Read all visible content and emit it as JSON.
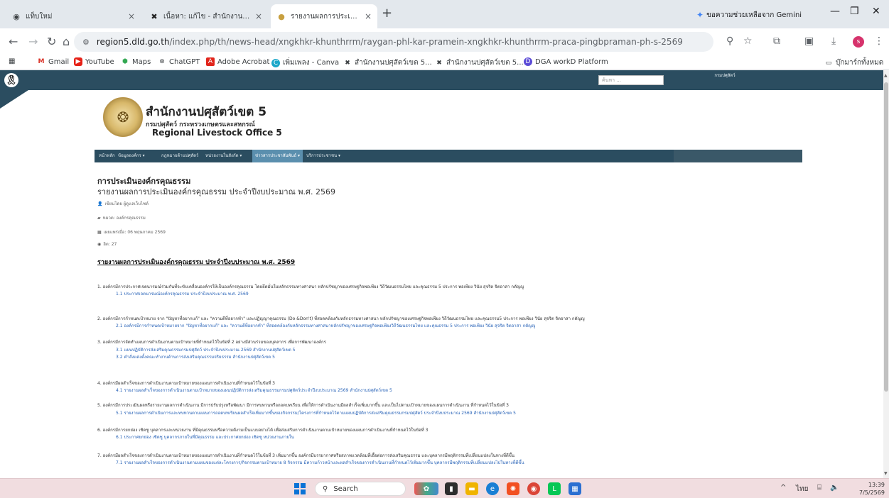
{
  "tabs": [
    {
      "title": "แท็บใหม่",
      "icon": "chrome-icon"
    },
    {
      "title": "เนื้อหา: แก้ไข - สำนักงานปศุสัตว์เขต",
      "icon": "dld-logo-icon"
    },
    {
      "title": "รายงานผลการประเมินองค์กรคุณธรรม",
      "icon": "site-favicon-icon"
    }
  ],
  "gemini_label": "ขอความช่วยเหลือจาก Gemini",
  "address": {
    "host": "region5.dld.go.th",
    "path": "/index.php/th/news-head/xngkhkr-khunthrrm/raygan-phl-kar-pramein-xngkhkr-khunthrrm-praca-pingbpraman-ph-s-2569"
  },
  "bookmarks": [
    {
      "label": "Gmail",
      "icon": "gmail-icon"
    },
    {
      "label": "YouTube",
      "icon": "youtube-icon"
    },
    {
      "label": "Maps",
      "icon": "maps-icon"
    },
    {
      "label": "ChatGPT",
      "icon": "chatgpt-icon"
    },
    {
      "label": "Adobe Acrobat",
      "icon": "acrobat-icon"
    },
    {
      "label": "เพิ่มเพลง - Canva",
      "icon": "canva-icon"
    },
    {
      "label": "สำนักงานปศุสัตว์เขต 5...",
      "icon": "dld-logo-icon"
    },
    {
      "label": "สำนักงานปศุสัตว์เขต 5...",
      "icon": "dld-logo-icon"
    },
    {
      "label": "DGA workD Platform",
      "icon": "dga-icon"
    }
  ],
  "all_bookmarks": "บุ๊กมาร์กทั้งหมด",
  "site": {
    "search_placeholder": "ค้นหา ...",
    "dept_link": "กรมปศุสัตว์",
    "title_th": "สำนักงานปศุสัตว์เขต 5",
    "subtitle_th": "กรมปศุสัตว์ กระทรวงเกษตรและสหกรณ์",
    "title_en": "Regional Livestock Office 5",
    "nav": [
      "หน้าหลัก",
      "ข้อมูลองค์กร ▾",
      "กฎหมายด้านปศุสัตว์",
      "หน่วยงานในสังกัด ▾",
      "ข่าวสารประชาสัมพันธ์ ▾",
      "บริการประชาชน ▾"
    ]
  },
  "article": {
    "heading": "การประเมินองค์กรคุณธรรม",
    "subheading": "รายงานผลการประเมินองค์กรคุณธรรม ประจำปีงบประมาณ พ.ศ. 2569",
    "meta": [
      "เขียนโดย ผู้ดูแลเว็บไซต์",
      "หมวด: องค์กรคุณธรรม",
      "เผยแพร่เมื่อ: 06 พฤษภาคม 2569",
      "ฮิต: 27"
    ],
    "section_title": "รายงานผลการประเมินองค์กรคุณธรรม ประจำปีงบประมาณ พ.ศ. 2569",
    "items": [
      {
        "text": "1. องค์กรมีการประกาศเจตนารมณ์ร่วมกันที่จะขับเคลื่อนองค์กรให้เป็นองค์กรคุณธรรม โดยยึดมั่นในหลักธรรมทางศาสนา หลักปรัชญาของเศรษฐกิจพอเพียง วิถีวัฒนธรรมไทย และคุณธรรม 5 ประการ พอเพียง วินัย สุจริต จิตอาสา กตัญญู",
        "subs": [
          "1.1 ประกาศเจตนารมณ์องค์กรคุณธรรม ประจำปีงบประมาณ พ.ศ. 2569"
        ]
      },
      {
        "text": "2. องค์กรมีการกำหนดเป้าหมาย จาก \"ปัญหาที่อยากแก้\" และ \"ความดีที่อยากทำ\" และปฏิญญาคุณธรรม (Do &Don't) ที่สอดคล้องกับหลักธรรมทางศาสนา หลักปรัชญาของเศรษฐกิจพอเพียง วิถีวัฒนธรรมไทย และคุณธรรม5 ประการ พอเพียง วินัย สุจริต จิตอาสา กตัญญู",
        "subs": [
          "2.1 องค์กรมีการกำหนดเป้าหมายจาก \"ปัญหาที่อยากแก้\" และ \"ความดีที่อยากทำ\" ที่สอดคล้องกับหลักธรรมทางศาสนาหลักปรัชญาของเศรษฐกิจพอเพียงวิถีวัฒนธรรมไทย และคุณธรรม 5 ประการ พอเพียง วินัย สุจริต จิตอาสา กตัญญู"
        ]
      },
      {
        "text": "3. องค์กรมีการจัดทำแผนการดำเนินงานตามเป้าหมายที่กำหนดไว้ในข้อที่ 2 อย่างมีส่วนร่วมของบุคลากร เพื่อการพัฒนาองค์กร",
        "subs": [
          "3.1 แผนปฏิบัติการส่งเสริมคุณธรรมกรมปศุสัตว์ ประจำปีงบประมาณ 2569 สำนักงานปศุสัตว์เขต 5",
          "3.2 คำสั่งแต่งตั้งคณะทำงานด้านการส่งเสริมคุณธรรมจริยธรรม สำนักงานปศุสัตว์เขต 5"
        ]
      },
      {
        "text": "4. องค์กรมีผลสำเร็จของการดำเนินงานตามเป้าหมายของแผนการดำเนินงานที่กำหนดไว้ในข้อที่ 3",
        "subs": [
          "4.1 รายงานผลสำเร็จของการดำเนินงานตามเป้าหมายของแผนปฏิบัติการส่งเสริมคุณธรรมกรมปศุสัตว์ประจำปีงบประมาณ 2569 สำนักงานปศุสัตว์เขต 5"
        ]
      },
      {
        "text": "5. องค์กรมีการประเมินผลหรือรายงานผลการดำเนินงาน มีการปรับปรุงหรือพัฒนา มีการทบทวนหรือถอดบทเรียน เพื่อให้การดำเนินงานมีผลสำเร็จเพิ่มมากขึ้น และเป็นไปตามเป้าหมายของแผนการดำเนินงาน ที่กำหนดไว้ในข้อที่ 3",
        "subs": [
          "5.1 รายงานผลการดำเนินการและทบทวนตามแผนการถอดบทเรียนผลสำเร็จเพิ่มมากขึ้นของกิจกรรม/โครงการที่กำหนดไว้ตามแผนปฏิบัติการส่งเสริมคุณธรรมกรมปศุสัตว์ ประจำปีงบประมาณ 2569 สำนักงานปศุสัตว์เขต 5"
        ]
      },
      {
        "text": "6. องค์กรมีการยกย่อง เชิดชู บุคลากรและหน่วยงาน ที่มีคุณธรรมหรือความดีงามเป็นแบบอย่างได้ เพื่อส่งเสริมการดำเนินงานตามเป้าหมายของแผนการดำเนินงานที่กำหนดไว้ในข้อที่ 3",
        "subs": [
          "6.1 ประกาศยกย่อง เชิดชู บุคลากรภายในที่มีคุณธรรม และประกาศยกย่อง เชิดชู หน่วยงานภายใน"
        ]
      },
      {
        "text": "7. องค์กรมีผลสำเร็จของการดำเนินงานตามเป้าหมายของแผนการดำเนินงานที่กำหนดไว้ในข้อที่ 3 เพิ่มมากขึ้น องค์กรมีบรรยากาศหรือสภาพแวดล้อมที่เอื้อต่อการส่งเสริมคุณธรรม และบุคลากรมีพฤติกรรมที่เปลี่ยนแปลงในทางที่ดีขึ้น",
        "subs": [
          "7.1 รายงานผลสำเร็จของการดำเนินงานตามแผนของแต่ละโครงการ/กิจกรรมตามเป้าหมาย 8 กิจกรรม มีความก้าวหน้าและผลสำเร็จของการดำเนินงานที่กำหนดไว้เพิ่มมากขึ้น บุคลากรมีพฤติกรรมที่เปลี่ยนแปลงไปในทางที่ดีขึ้น"
        ]
      }
    ]
  },
  "taskbar": {
    "search_label": "Search",
    "lang": "ไทย",
    "time": "13:39",
    "date": "7/5/2569"
  },
  "colors": {
    "site_bar": "#2b4d60",
    "nav_active": "#5b8fae",
    "link": "#2a64b8"
  }
}
